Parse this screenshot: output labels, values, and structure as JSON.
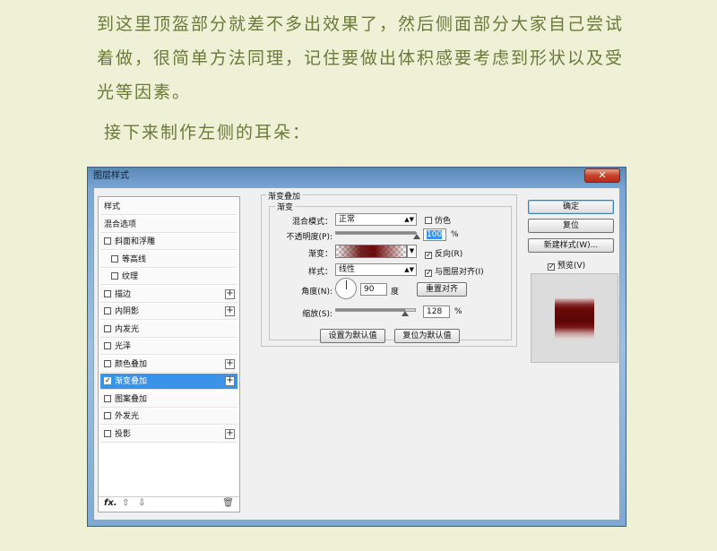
{
  "article": {
    "paragraph_1_line_1": "到这里顶盔部分就差不多出效果了，然后侧面部分大家自己尝试",
    "paragraph_1_line_2": "着做，很简单方法同理，记住要做出体积感要考虑到形状以及受",
    "paragraph_1_line_3": "光等因素。",
    "sub_heading": "接下来制作左侧的耳朵："
  },
  "window": {
    "title": "图层样式",
    "close_label": "✕"
  },
  "style_list": {
    "items": [
      {
        "label": "样式",
        "has_checkbox": false,
        "indent": false,
        "checked": false,
        "plus": false
      },
      {
        "label": "混合选项",
        "has_checkbox": false,
        "indent": false,
        "checked": false,
        "plus": false
      },
      {
        "label": "斜面和浮雕",
        "has_checkbox": true,
        "indent": false,
        "checked": false,
        "plus": false
      },
      {
        "label": "等高线",
        "has_checkbox": true,
        "indent": true,
        "checked": false,
        "plus": false
      },
      {
        "label": "纹理",
        "has_checkbox": true,
        "indent": true,
        "checked": false,
        "plus": false
      },
      {
        "label": "描边",
        "has_checkbox": true,
        "indent": false,
        "checked": false,
        "plus": true
      },
      {
        "label": "内阴影",
        "has_checkbox": true,
        "indent": false,
        "checked": false,
        "plus": true
      },
      {
        "label": "内发光",
        "has_checkbox": true,
        "indent": false,
        "checked": false,
        "plus": false
      },
      {
        "label": "光泽",
        "has_checkbox": true,
        "indent": false,
        "checked": false,
        "plus": false
      },
      {
        "label": "颜色叠加",
        "has_checkbox": true,
        "indent": false,
        "checked": false,
        "plus": true
      },
      {
        "label": "渐变叠加",
        "has_checkbox": true,
        "indent": false,
        "checked": true,
        "plus": true,
        "selected": true
      },
      {
        "label": "图案叠加",
        "has_checkbox": true,
        "indent": false,
        "checked": false,
        "plus": false
      },
      {
        "label": "外发光",
        "has_checkbox": true,
        "indent": false,
        "checked": false,
        "plus": false
      },
      {
        "label": "投影",
        "has_checkbox": true,
        "indent": false,
        "checked": false,
        "plus": true
      }
    ],
    "footer": {
      "fx": "fx.",
      "up": "⇧",
      "down": "⇩",
      "trash": "🗑"
    }
  },
  "gradient_overlay": {
    "section_title": "渐变叠加",
    "group_title": "渐变",
    "blend_mode_label": "混合模式：",
    "blend_mode_value": "正常",
    "dither_label": "仿色",
    "opacity_label": "不透明度(P):",
    "opacity_value": "100",
    "opacity_unit": "%",
    "opacity_fraction": 1.0,
    "gradient_label": "渐变：",
    "reverse_label": "反向(R)",
    "reverse_checked": true,
    "style_label": "样式：",
    "style_value": "线性",
    "align_label": "与图层对齐(I)",
    "align_checked": true,
    "angle_label": "角度(N):",
    "angle_value": "90",
    "angle_unit": "度",
    "reset_align_label": "重置对齐",
    "scale_label": "缩放(S):",
    "scale_value": "128",
    "scale_unit": "%",
    "scale_fraction": 0.85,
    "make_default_label": "设置为默认值",
    "reset_default_label": "复位为默认值"
  },
  "buttons": {
    "ok": "确定",
    "reset": "复位",
    "new_style": "新建样式(W)...",
    "preview_label": "预览(V)",
    "preview_checked": true
  },
  "colors": {
    "accent": "#3a93e6",
    "text_olive": "#6b7a3a",
    "gradient_dark_red": "#6b0a0a"
  }
}
